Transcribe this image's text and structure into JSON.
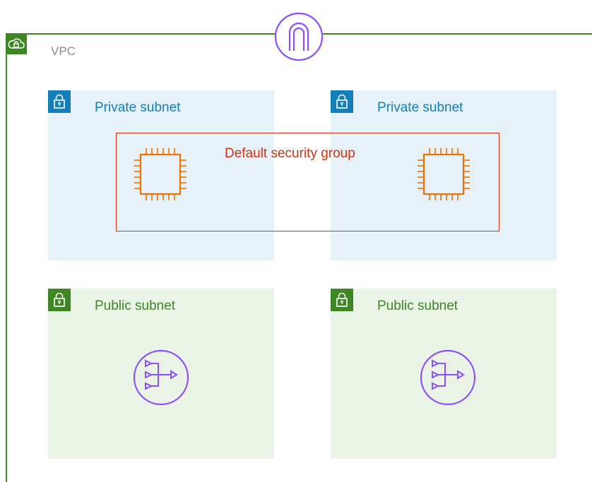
{
  "vpc": {
    "label": "VPC",
    "border_color": "#3f8624",
    "badge_icon": "vpc-cloud-lock-icon",
    "gateway_icon": "internet-gateway-icon"
  },
  "subnets": [
    {
      "type": "private",
      "label": "Private subnet",
      "color": "#147eba",
      "icon": "lock-icon",
      "resource_icon": "ec2-instance-icon"
    },
    {
      "type": "private",
      "label": "Private subnet",
      "color": "#147eba",
      "icon": "lock-icon",
      "resource_icon": "ec2-instance-icon"
    },
    {
      "type": "public",
      "label": "Public subnet",
      "color": "#3f8624",
      "icon": "lock-icon",
      "resource_icon": "nat-gateway-icon"
    },
    {
      "type": "public",
      "label": "Public subnet",
      "color": "#3f8624",
      "icon": "lock-icon",
      "resource_icon": "nat-gateway-icon"
    }
  ],
  "security_group": {
    "label": "Default security group",
    "color": "#d13212"
  },
  "colors": {
    "private_fill": "#e6f2f8",
    "public_fill": "#e9f3e6",
    "ec2_orange": "#ed7100",
    "nat_purple": "#8c4fff"
  }
}
